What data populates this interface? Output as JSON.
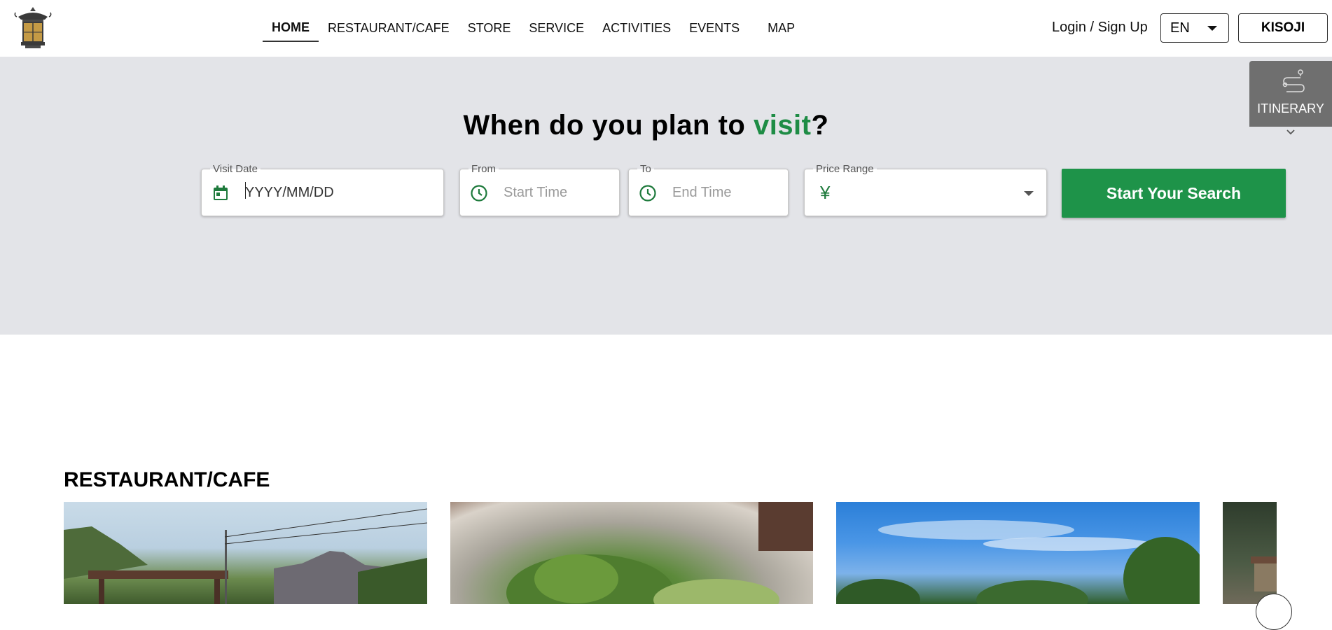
{
  "header": {
    "logo_icon": "lantern-logo-icon",
    "nav": [
      {
        "label": "HOME",
        "active": true
      },
      {
        "label": "RESTAURANT/CAFE",
        "active": false
      },
      {
        "label": "STORE",
        "active": false
      },
      {
        "label": "SERVICE",
        "active": false
      },
      {
        "label": "ACTIVITIES",
        "active": false
      },
      {
        "label": "EVENTS",
        "active": false
      },
      {
        "label": "MAP",
        "active": false
      }
    ],
    "login_label": "Login / Sign Up",
    "language": "EN",
    "region_button": "KISOJI"
  },
  "hero": {
    "title_prefix": "When do you plan to ",
    "title_accent": "visit",
    "title_suffix": "?",
    "accent_color": "#1e8c45",
    "visit_date": {
      "label": "Visit Date",
      "placeholder": "YYYY/MM/DD",
      "icon": "calendar-icon"
    },
    "from": {
      "label": "From",
      "placeholder": "Start Time",
      "icon": "clock-icon"
    },
    "to": {
      "label": "To",
      "placeholder": "End Time",
      "icon": "clock-icon"
    },
    "price_range": {
      "label": "Price Range",
      "prefix": "¥",
      "value": ""
    },
    "search_button": "Start Your Search",
    "button_color": "#1e9349"
  },
  "itinerary": {
    "label": "ITINERARY",
    "icon": "route-icon"
  },
  "section": {
    "title": "RESTAURANT/CAFE",
    "cards": [
      {
        "image": "gazebo-mountain-photo"
      },
      {
        "image": "salad-dish-photo"
      },
      {
        "image": "blue-sky-trees-photo"
      },
      {
        "image": "forest-building-photo"
      }
    ]
  }
}
